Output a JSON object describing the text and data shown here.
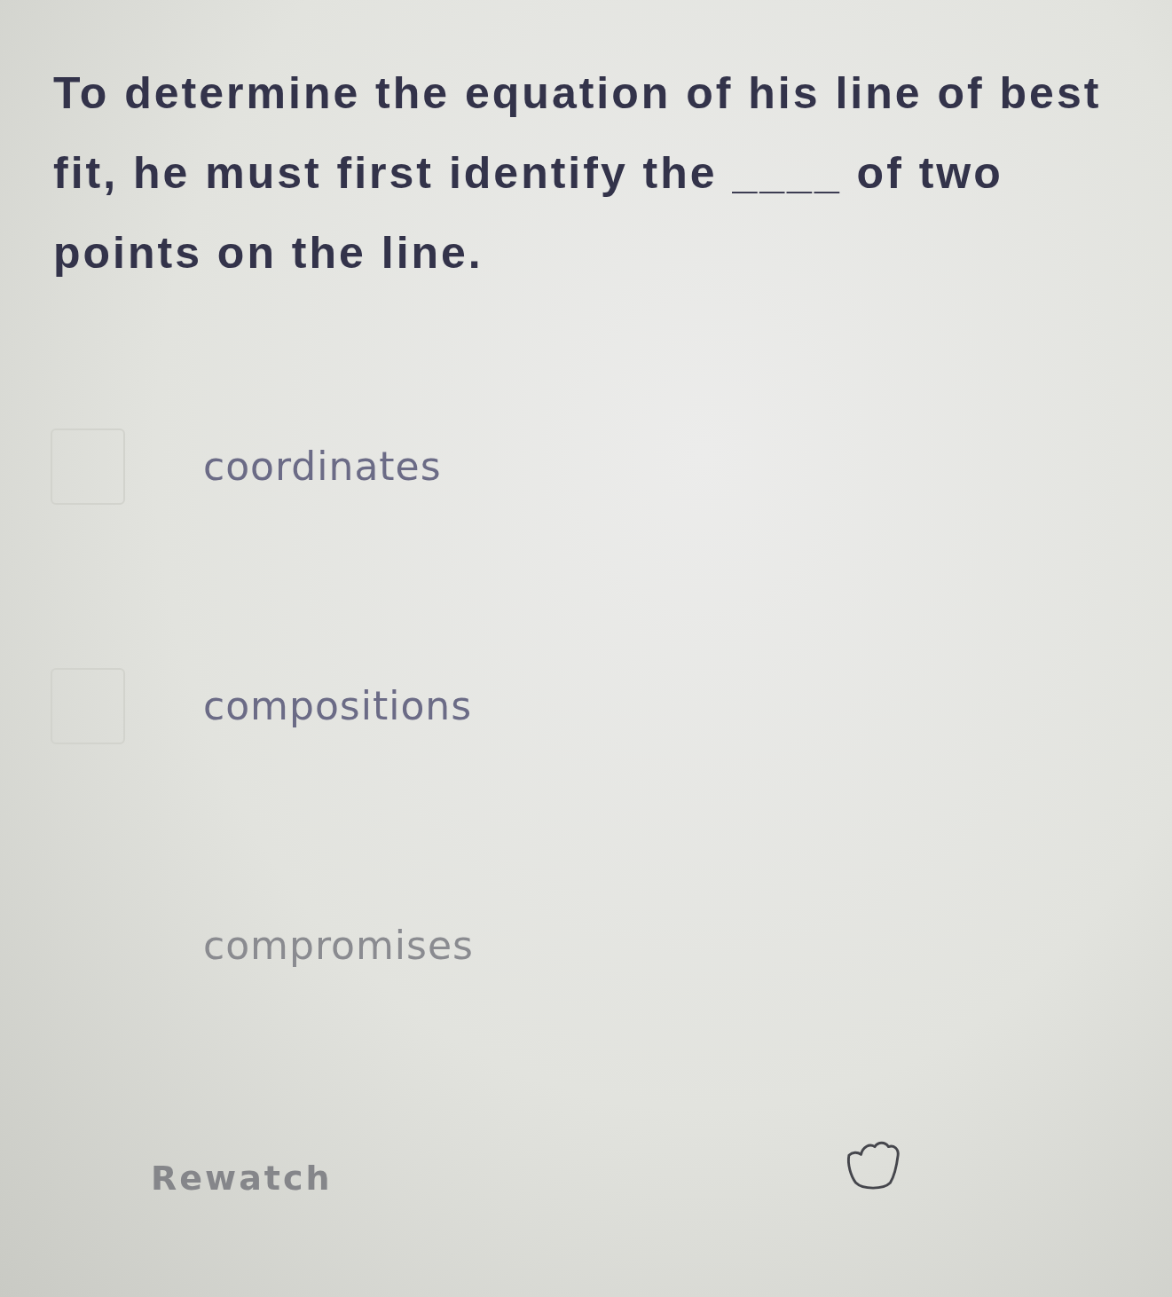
{
  "question": {
    "text": "To determine the equation of his line of best fit, he must first identify the ____ of two points on the line."
  },
  "options": [
    {
      "kind": "checkbox",
      "label": "coordinates",
      "checked": false
    },
    {
      "kind": "checkbox",
      "label": "compositions",
      "checked": false
    },
    {
      "kind": "plain",
      "label": "compromises"
    }
  ],
  "footer": {
    "rewatch_button": "Rewatch"
  }
}
